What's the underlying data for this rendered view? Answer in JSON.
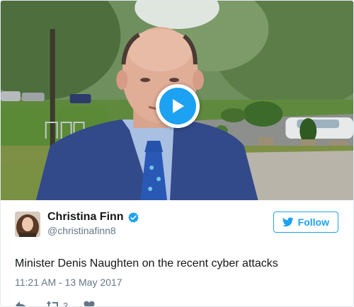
{
  "tweet": {
    "author": {
      "display_name": "Christina Finn",
      "handle": "@christinafinn8",
      "verified": true
    },
    "follow_label": "Follow",
    "text": "Minister Denis Naughten on the recent cyber attacks",
    "timestamp": "11:21 AM - 13 May 2017",
    "retweet_count": "3"
  },
  "media": {
    "type": "video",
    "play_icon": "play-icon"
  },
  "icons": {
    "reply": "reply-icon",
    "retweet": "retweet-icon",
    "like": "heart-icon",
    "follow": "twitter-bird-icon",
    "verified": "verified-badge-icon"
  },
  "colors": {
    "accent": "#1da1f2",
    "text": "#14171a",
    "secondary": "#657786",
    "border": "#e1e8ed"
  }
}
